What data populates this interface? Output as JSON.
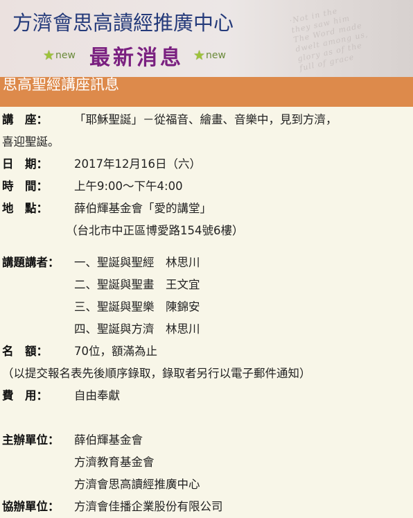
{
  "header": {
    "org_title": "方濟會思高讀經推廣中心",
    "news_title": "最新消息",
    "badge_left": "new",
    "badge_right": "new"
  },
  "section": {
    "title": "思高聖經講座訊息"
  },
  "event": {
    "topic_label": "講　座：",
    "topic_value": "「耶穌聖誕」－從福音、繪畫、音樂中，見到方濟，",
    "topic_value_cont": "喜迎聖誕。",
    "date_label": "日　期：",
    "date_value": "2017年12月16日（六）",
    "time_label": "時　間：",
    "time_value": "上午9:00～下午4:00",
    "place_label": "地　點：",
    "place_value": "薛伯輝基金會「愛的講堂」",
    "place_address": "（台北市中正區博愛路154號6樓）",
    "speakers_label": "講題講者：",
    "speakers": [
      "一、聖誕與聖經　林思川",
      "二、聖誕與聖畫　王文宜",
      "三、聖誕與聖樂　陳錦安",
      "四、聖誕與方濟　林思川"
    ],
    "quota_label": "名　額：",
    "quota_value": "70位，額滿為止",
    "quota_note": "（以提交報名表先後順序錄取，錄取者另行以電子郵件通知）",
    "fee_label": "費　用：",
    "fee_value": "自由奉獻",
    "organizer_label": "主辦單位：",
    "organizers": [
      "薛伯輝基金會",
      "方濟教育基金會",
      "方濟會思高讀經推廣中心"
    ],
    "co_organizer_label": "協辦單位：",
    "co_organizer_value": "方濟會佳播企業股份有限公司"
  }
}
